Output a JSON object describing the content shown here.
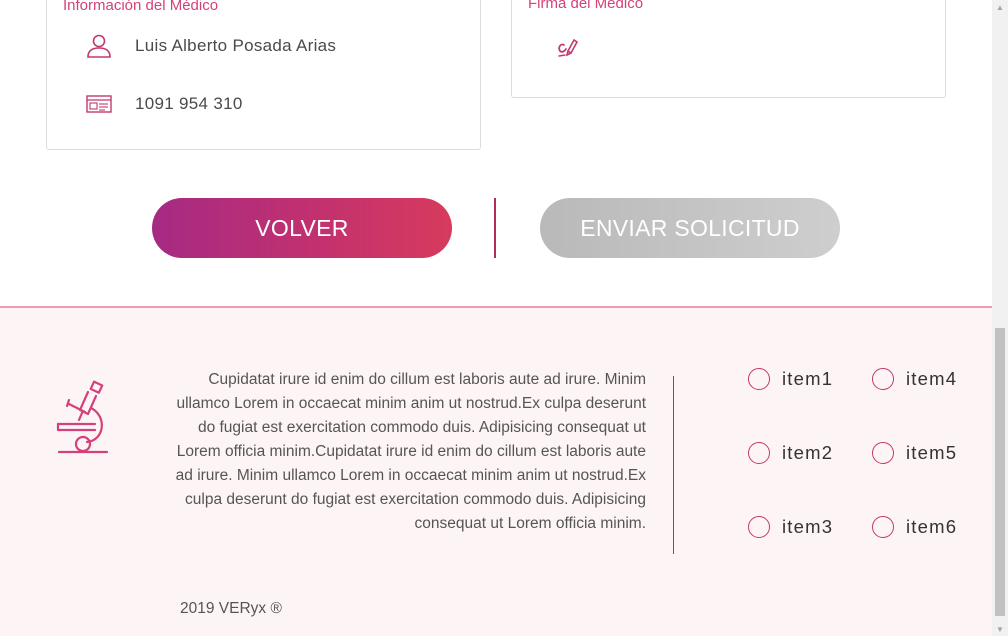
{
  "doctor_info": {
    "title": "Información del Médico",
    "name": "Luis Alberto Posada Arias",
    "id_number": "1091 954 310"
  },
  "signature": {
    "title": "Firma del Médico"
  },
  "actions": {
    "back_label": "VOLVER",
    "submit_label": "ENVIAR SOLICITUD"
  },
  "footer": {
    "text": "Cupidatat irure id enim do cillum est laboris aute ad irure. Minim ullamco Lorem in occaecat minim anim ut nostrud.Ex culpa deserunt do fugiat est exercitation commodo duis. Adipisicing consequat ut Lorem officia minim.Cupidatat irure id enim do cillum est laboris aute ad irure. Minim ullamco Lorem in occaecat minim anim ut nostrud.Ex culpa deserunt do fugiat est exercitation commodo duis. Adipisicing consequat ut Lorem officia minim.",
    "items": [
      "item1",
      "item2",
      "item3",
      "item4",
      "item5",
      "item6"
    ],
    "copyright": "2019 VERyx ®"
  },
  "colors": {
    "accent": "#d4417a",
    "button_gradient_start": "#a62a83",
    "button_gradient_end": "#d73a5c",
    "disabled": "#c4c4c4",
    "footer_bg": "#fdf4f6"
  }
}
